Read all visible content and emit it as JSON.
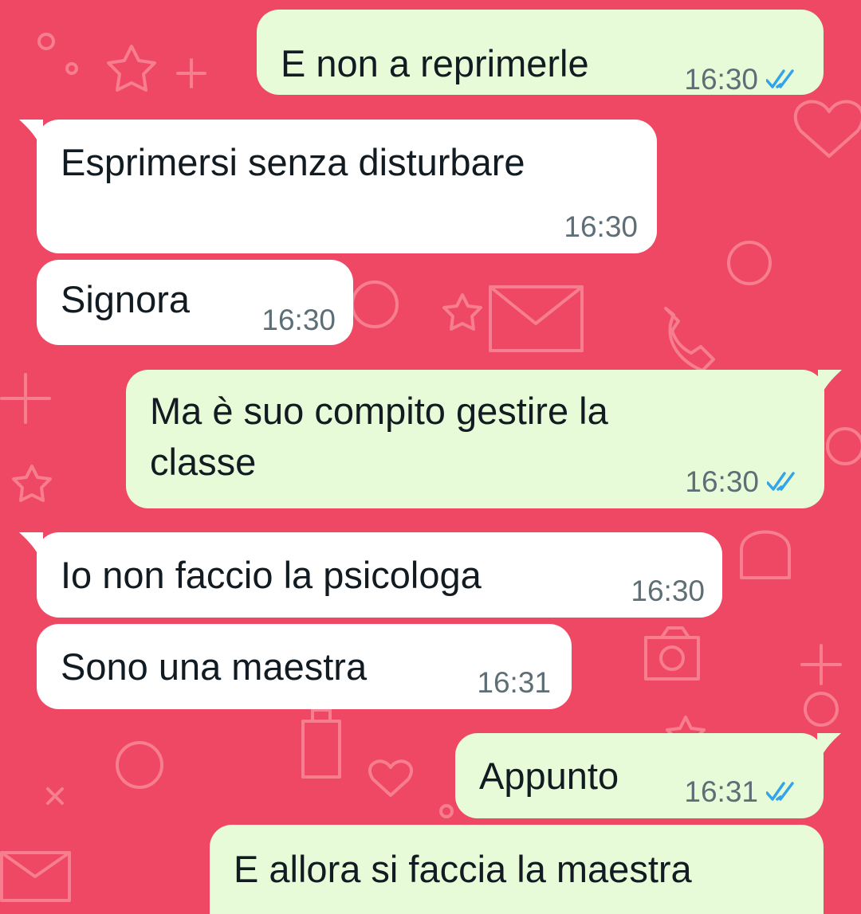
{
  "theme": {
    "wallpaper": "#ef4864",
    "outgoing_bubble": "#e7fbd8",
    "incoming_bubble": "#ffffff",
    "text": "#111b21",
    "time": "#5e6e76",
    "read_ticks": "#34a4e8"
  },
  "messages": [
    {
      "direction": "outgoing",
      "text": "E non a reprimerle",
      "time": "16:30",
      "status": "read",
      "status_icon": "double-check-icon"
    },
    {
      "direction": "incoming",
      "text": "Esprimersi senza disturbare",
      "time": "16:30"
    },
    {
      "direction": "incoming",
      "text": "Signora",
      "time": "16:30"
    },
    {
      "direction": "outgoing",
      "text": "Ma è suo compito gestire la\nclasse",
      "time": "16:30",
      "status": "read",
      "status_icon": "double-check-icon"
    },
    {
      "direction": "incoming",
      "text": "Io non faccio la psicologa",
      "time": "16:30"
    },
    {
      "direction": "incoming",
      "text": "Sono una maestra",
      "time": "16:31"
    },
    {
      "direction": "outgoing",
      "text": "Appunto",
      "time": "16:31",
      "status": "read",
      "status_icon": "double-check-icon"
    },
    {
      "direction": "outgoing",
      "text": "E allora si faccia la maestra"
    }
  ]
}
